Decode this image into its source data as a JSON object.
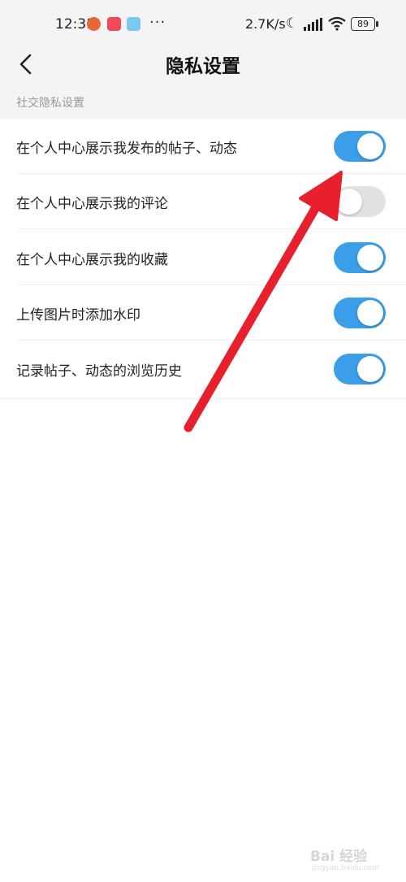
{
  "status_bar": {
    "time": "12:31",
    "more": "···",
    "net_speed": "2.7K/s",
    "battery": "89",
    "icons": [
      "app-icon",
      "app-icon",
      "app-icon",
      "moon-icon",
      "signal-icon",
      "wifi-icon",
      "battery-icon"
    ]
  },
  "nav": {
    "title": "隐私设置",
    "back_icon": "chevron-left-icon"
  },
  "section": {
    "title": "社交隐私设置"
  },
  "settings": [
    {
      "label": "在个人中心展示我发布的帖子、动态",
      "enabled": true
    },
    {
      "label": "在个人中心展示我的评论",
      "enabled": false
    },
    {
      "label": "在个人中心展示我的收藏",
      "enabled": true
    },
    {
      "label": "上传图片时添加水印",
      "enabled": true
    },
    {
      "label": "记录帖子、动态的浏览历史",
      "enabled": true
    }
  ],
  "colors": {
    "toggle_on": "#3a9ee9",
    "toggle_off": "#e2e2e2",
    "arrow": "#e8202e",
    "header_bg": "#f4f4f4"
  },
  "watermark": {
    "text": "Bai 经验",
    "sub": "jingyan.baidu.com"
  }
}
